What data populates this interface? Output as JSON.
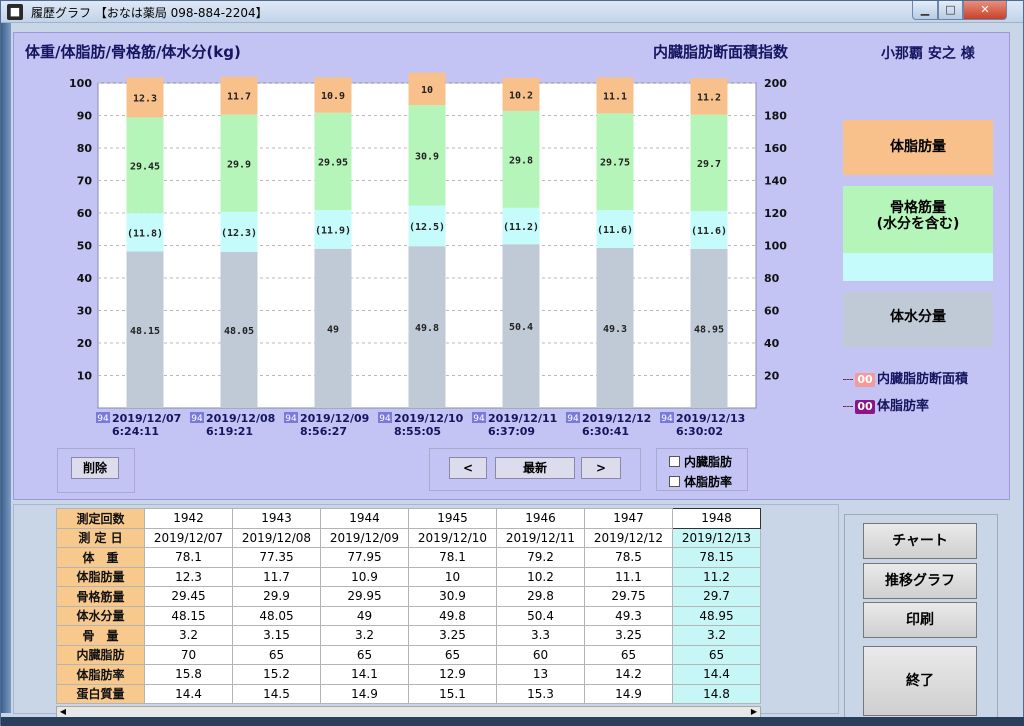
{
  "window": {
    "title": "履歴グラフ 【おなは薬局 098-884-2204】",
    "min": "▁",
    "max": "□",
    "close": "✕"
  },
  "header": {
    "left_label": "体重/体脂肪/骨格筋/体水分(kg)",
    "mid_label": "内臓脂肪断面積指数",
    "patient": "小那覇 安之 様"
  },
  "legend": {
    "fat": "体脂肪量",
    "muscle": "骨格筋量\n(水分を含む)",
    "water": "体水分量",
    "visceral_chip": "00",
    "visceral": "内臓脂肪断面積",
    "bodyfat_chip": "00",
    "bodyfat": "体脂肪率"
  },
  "controls": {
    "delete": "削除",
    "prev": "<",
    "latest": "最新",
    "next": ">",
    "chk_visceral": "内臓脂肪",
    "chk_bodyfat": "体脂肪率"
  },
  "chart_data": {
    "type": "bar",
    "stacked": true,
    "categories": [
      "2019/12/07 6:24:11",
      "2019/12/08 6:19:21",
      "2019/12/09 8:56:27",
      "2019/12/10 8:55:05",
      "2019/12/11 6:37:09",
      "2019/12/12 6:30:41",
      "2019/12/13 6:30:02"
    ],
    "category_badge": "94",
    "series": [
      {
        "name": "体水分量",
        "color": "#c0cad6",
        "values": [
          48.15,
          48.05,
          49,
          49.8,
          50.4,
          49.3,
          48.95
        ],
        "labels": [
          "48.15",
          "48.05",
          "49",
          "49.8",
          "50.4",
          "49.3",
          "48.95"
        ]
      },
      {
        "name": "",
        "color": "#c6fbfb",
        "values": [
          11.8,
          12.3,
          11.9,
          12.5,
          11.2,
          11.6,
          11.6
        ],
        "labels": [
          "(11.8)",
          "(12.3)",
          "(11.9)",
          "(12.5)",
          "(11.2)",
          "(11.6)",
          "(11.6)"
        ]
      },
      {
        "name": "骨格筋量",
        "color": "#b6f5b9",
        "values": [
          29.45,
          29.9,
          29.95,
          30.9,
          29.8,
          29.75,
          29.7
        ],
        "labels": [
          "29.45",
          "29.9",
          "29.95",
          "30.9",
          "29.8",
          "29.75",
          "29.7"
        ]
      },
      {
        "name": "体脂肪量",
        "color": "#f8c08a",
        "values": [
          12.3,
          11.7,
          10.9,
          10,
          10.2,
          11.1,
          11.2
        ],
        "labels": [
          "12.3",
          "11.7",
          "10.9",
          "10",
          "10.2",
          "11.1",
          "11.2"
        ]
      }
    ],
    "y_left": {
      "min": 0,
      "max": 100,
      "ticks": [
        "10",
        "20",
        "30",
        "40",
        "50",
        "60",
        "70",
        "80",
        "90",
        "100"
      ]
    },
    "y_right": {
      "min": 0,
      "max": 200,
      "ticks": [
        "20",
        "40",
        "60",
        "80",
        "100",
        "120",
        "140",
        "160",
        "180",
        "200"
      ]
    },
    "grid": true
  },
  "table": {
    "row_headers": [
      "測定回数",
      "測 定 日",
      "体　重",
      "体脂肪量",
      "骨格筋量",
      "体水分量",
      "骨　量",
      "内臓脂肪",
      "体脂肪率",
      "蛋白質量"
    ],
    "columns": [
      [
        "1942",
        "2019/12/07",
        "78.1",
        "12.3",
        "29.45",
        "48.15",
        "3.2",
        "70",
        "15.8",
        "14.4"
      ],
      [
        "1943",
        "2019/12/08",
        "77.35",
        "11.7",
        "29.9",
        "48.05",
        "3.15",
        "65",
        "15.2",
        "14.5"
      ],
      [
        "1944",
        "2019/12/09",
        "77.95",
        "10.9",
        "29.95",
        "49",
        "3.2",
        "65",
        "14.1",
        "14.9"
      ],
      [
        "1945",
        "2019/12/10",
        "78.1",
        "10",
        "30.9",
        "49.8",
        "3.25",
        "65",
        "12.9",
        "15.1"
      ],
      [
        "1946",
        "2019/12/11",
        "79.2",
        "10.2",
        "29.8",
        "50.4",
        "3.3",
        "60",
        "13",
        "15.3"
      ],
      [
        "1947",
        "2019/12/12",
        "78.5",
        "11.1",
        "29.75",
        "49.3",
        "3.25",
        "65",
        "14.2",
        "14.9"
      ],
      [
        "1948",
        "2019/12/13",
        "78.15",
        "11.2",
        "29.7",
        "48.95",
        "3.2",
        "65",
        "14.4",
        "14.8"
      ]
    ]
  },
  "side_buttons": {
    "chart": "チャート",
    "trend": "推移グラフ",
    "print": "印刷",
    "exit": "終了"
  },
  "scroll": {
    "left": "◀",
    "right": "▶"
  }
}
